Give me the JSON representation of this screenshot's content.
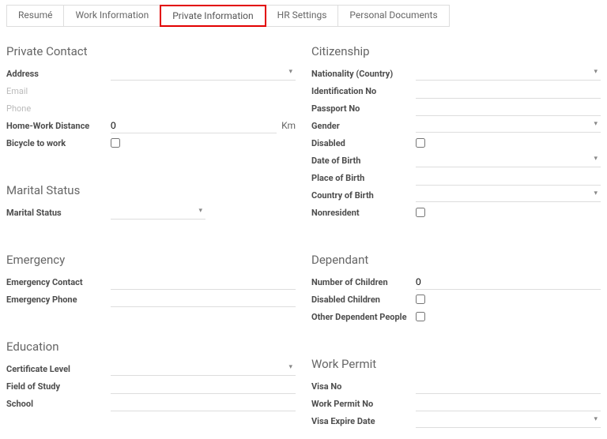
{
  "tabs": {
    "resume": "Resumé",
    "work_info": "Work Information",
    "private_info": "Private Information",
    "hr_settings": "HR Settings",
    "personal_docs": "Personal Documents"
  },
  "sections": {
    "private_contact": {
      "title": "Private Contact",
      "address": "Address",
      "email": "Email",
      "phone": "Phone",
      "home_work_distance": "Home-Work Distance",
      "home_work_distance_value": "0",
      "distance_unit": "Km",
      "bicycle_to_work": "Bicycle to work"
    },
    "marital_status": {
      "title": "Marital Status",
      "marital_status": "Marital Status"
    },
    "emergency": {
      "title": "Emergency",
      "contact": "Emergency Contact",
      "phone": "Emergency Phone"
    },
    "education": {
      "title": "Education",
      "cert_level": "Certificate Level",
      "field_of_study": "Field of Study",
      "school": "School"
    },
    "citizenship": {
      "title": "Citizenship",
      "nationality": "Nationality (Country)",
      "identification_no": "Identification No",
      "passport_no": "Passport No",
      "gender": "Gender",
      "disabled": "Disabled",
      "date_of_birth": "Date of Birth",
      "place_of_birth": "Place of Birth",
      "country_of_birth": "Country of Birth",
      "nonresident": "Nonresident"
    },
    "dependant": {
      "title": "Dependant",
      "number_of_children": "Number of Children",
      "number_of_children_value": "0",
      "disabled_children": "Disabled Children",
      "other_dependent": "Other Dependent People"
    },
    "work_permit": {
      "title": "Work Permit",
      "visa_no": "Visa No",
      "work_permit_no": "Work Permit No",
      "visa_expire": "Visa Expire Date"
    }
  }
}
